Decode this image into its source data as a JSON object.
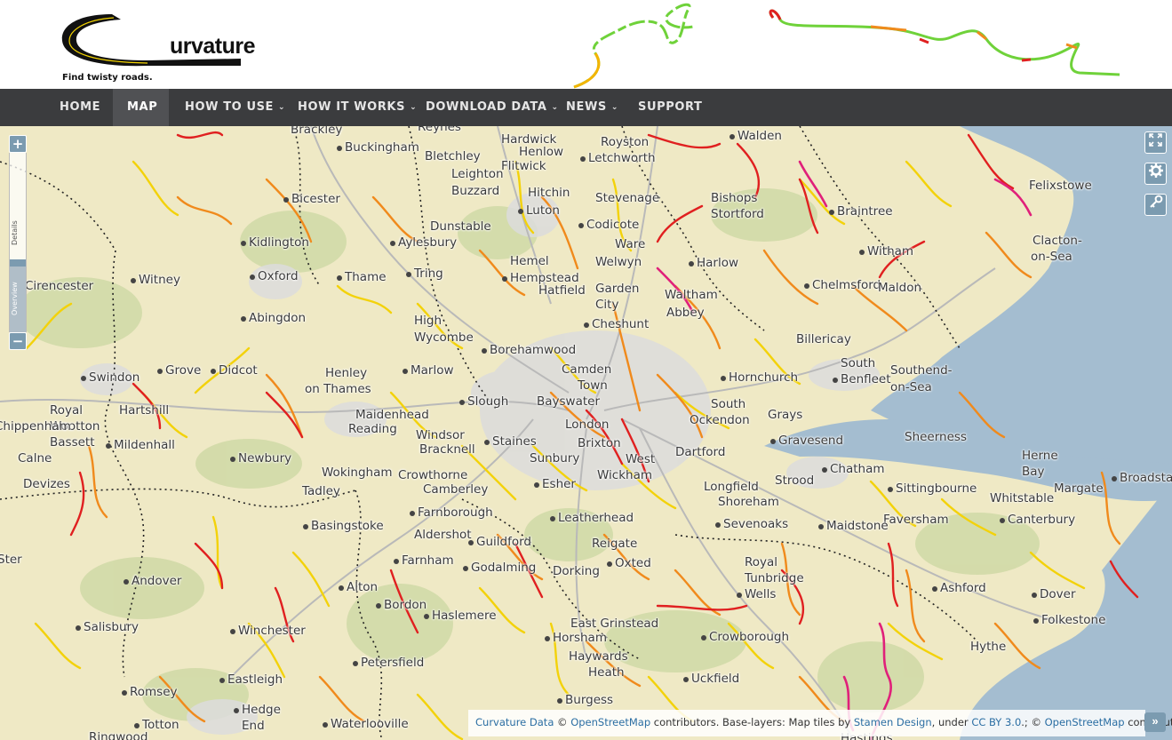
{
  "brand": {
    "logo_text": "urvature",
    "tagline": "Find twisty roads."
  },
  "nav": {
    "items": [
      {
        "label": "HOME",
        "dropdown": false,
        "active": false
      },
      {
        "label": "MAP",
        "dropdown": false,
        "active": true
      },
      {
        "label": "HOW TO USE",
        "dropdown": true,
        "active": false
      },
      {
        "label": "HOW IT WORKS",
        "dropdown": true,
        "active": false
      },
      {
        "label": "DOWNLOAD DATA",
        "dropdown": true,
        "active": false
      },
      {
        "label": "NEWS",
        "dropdown": true,
        "active": false
      },
      {
        "label": "SUPPORT",
        "dropdown": false,
        "active": false
      }
    ]
  },
  "map_controls": {
    "zoom_in": "+",
    "zoom_out": "−",
    "details_label": "Details",
    "overview_label": "Overview",
    "fullscreen_icon": "fullscreen-icon",
    "settings_icon": "gear-icon",
    "key_icon": "key-icon",
    "attribution_toggle": "»"
  },
  "attribution": {
    "curvature_link": "Curvature Data",
    "copyright": "©",
    "osm_link": "OpenStreetMap",
    "text1": "contributors. Base-layers: Map tiles by",
    "stamen_link": "Stamen Design",
    "text2": ", under",
    "cc_link": "CC BY 3.0",
    "text3": ".; ©",
    "osm_link2": "OpenStreetMap",
    "text4": "contributors."
  },
  "places": [
    {
      "name": "Brackley"
    },
    {
      "name": "Reynes"
    },
    {
      "name": "Hardwick"
    },
    {
      "name": "Royston"
    },
    {
      "name": "Walden"
    },
    {
      "name": "Buckingham"
    },
    {
      "name": "Henlow"
    },
    {
      "name": "Letchworth"
    },
    {
      "name": "Bletchley"
    },
    {
      "name": "Flitwick"
    },
    {
      "name": "Leighton"
    },
    {
      "name": "Buzzard"
    },
    {
      "name": "Hitchin"
    },
    {
      "name": "Stevenage"
    },
    {
      "name": "Bishops"
    },
    {
      "name": "Felixstowe"
    },
    {
      "name": "Bicester"
    },
    {
      "name": "Luton"
    },
    {
      "name": "Stortford"
    },
    {
      "name": "Braintree"
    },
    {
      "name": "Dunstable"
    },
    {
      "name": "Codicote"
    },
    {
      "name": "Ware"
    },
    {
      "name": "Kidlington"
    },
    {
      "name": "Aylesbury"
    },
    {
      "name": "Witham"
    },
    {
      "name": "Clacton-"
    },
    {
      "name": "on-Sea"
    },
    {
      "name": "Hemel"
    },
    {
      "name": "Harlow"
    },
    {
      "name": "Hempstead"
    },
    {
      "name": "Welwyn"
    },
    {
      "name": "Garden"
    },
    {
      "name": "City"
    },
    {
      "name": "Cirencester"
    },
    {
      "name": "Witney"
    },
    {
      "name": "Oxford"
    },
    {
      "name": "Thame"
    },
    {
      "name": "Tring"
    },
    {
      "name": "Hatfield"
    },
    {
      "name": "Waltham"
    },
    {
      "name": "Abbey"
    },
    {
      "name": "Chelmsford"
    },
    {
      "name": "Maldon"
    },
    {
      "name": "Abingdon"
    },
    {
      "name": "High"
    },
    {
      "name": "Wycombe"
    },
    {
      "name": "Cheshunt"
    },
    {
      "name": "Billericay"
    },
    {
      "name": "Swindon"
    },
    {
      "name": "Grove"
    },
    {
      "name": "Didcot"
    },
    {
      "name": "Henley"
    },
    {
      "name": "on Thames"
    },
    {
      "name": "Marlow"
    },
    {
      "name": "Borehamwood"
    },
    {
      "name": "Camden"
    },
    {
      "name": "Town"
    },
    {
      "name": "Hornchurch"
    },
    {
      "name": "South"
    },
    {
      "name": "Benfleet"
    },
    {
      "name": "Southend-"
    },
    {
      "name": "on-Sea"
    },
    {
      "name": "Royal"
    },
    {
      "name": "Wootton"
    },
    {
      "name": "Bassett"
    },
    {
      "name": "Hartshill"
    },
    {
      "name": "Slough"
    },
    {
      "name": "Bayswater"
    },
    {
      "name": "South"
    },
    {
      "name": "Ockendon"
    },
    {
      "name": "Grays"
    },
    {
      "name": "Chippenham"
    },
    {
      "name": "Maidenhead"
    },
    {
      "name": "Reading"
    },
    {
      "name": "Windsor"
    },
    {
      "name": "London"
    },
    {
      "name": "Gravesend"
    },
    {
      "name": "Sheerness"
    },
    {
      "name": "Mildenhall"
    },
    {
      "name": "Bracknell"
    },
    {
      "name": "Staines"
    },
    {
      "name": "Brixton"
    },
    {
      "name": "Dartford"
    },
    {
      "name": "Calne"
    },
    {
      "name": "Newbury"
    },
    {
      "name": "Wokingham"
    },
    {
      "name": "Sunbury"
    },
    {
      "name": "West"
    },
    {
      "name": "Wickham"
    },
    {
      "name": "Chatham"
    },
    {
      "name": "Herne"
    },
    {
      "name": "Bay"
    },
    {
      "name": "Devizes"
    },
    {
      "name": "Crowthorne"
    },
    {
      "name": "Camberley"
    },
    {
      "name": "Esher"
    },
    {
      "name": "Longfield"
    },
    {
      "name": "Strood"
    },
    {
      "name": "Sittingbourne"
    },
    {
      "name": "Margate"
    },
    {
      "name": "Broadstairs"
    },
    {
      "name": "Tadley"
    },
    {
      "name": "Shoreham"
    },
    {
      "name": "Whitstable"
    },
    {
      "name": "Farnborough"
    },
    {
      "name": "Leatherhead"
    },
    {
      "name": "Sevenoaks"
    },
    {
      "name": "Faversham"
    },
    {
      "name": "Canterbury"
    },
    {
      "name": "Basingstoke"
    },
    {
      "name": "Aldershot"
    },
    {
      "name": "Maidstone"
    },
    {
      "name": "Guildford"
    },
    {
      "name": "Reigate"
    },
    {
      "name": "Farnham"
    },
    {
      "name": "Godalming"
    },
    {
      "name": "Oxted"
    },
    {
      "name": "Dorking"
    },
    {
      "name": "Royal"
    },
    {
      "name": "Tunbridge"
    },
    {
      "name": "Wells"
    },
    {
      "name": "Andover"
    },
    {
      "name": "Alton"
    },
    {
      "name": "Ashford"
    },
    {
      "name": "Dover"
    },
    {
      "name": "Bordon"
    },
    {
      "name": "Haslemere"
    },
    {
      "name": "East Grinstead"
    },
    {
      "name": "Folkestone"
    },
    {
      "name": "Salisbury"
    },
    {
      "name": "Winchester"
    },
    {
      "name": "Horsham"
    },
    {
      "name": "Crowborough"
    },
    {
      "name": "Hythe"
    },
    {
      "name": "Petersfield"
    },
    {
      "name": "Haywards"
    },
    {
      "name": "Heath"
    },
    {
      "name": "Eastleigh"
    },
    {
      "name": "Uckfield"
    },
    {
      "name": "Romsey"
    },
    {
      "name": "Burgess"
    },
    {
      "name": "Hedge"
    },
    {
      "name": "End"
    },
    {
      "name": "Totton"
    },
    {
      "name": "Waterlooville"
    },
    {
      "name": "Ringwood"
    },
    {
      "name": "Hastings"
    },
    {
      "name": "Oxford"
    },
    {
      "name": "Ster"
    }
  ],
  "colors": {
    "navbar_bg": "#3b3c3e",
    "navbar_active": "#505154",
    "sea": "#a4bdd0",
    "land": "#efe9c5",
    "road_yellow": "#f3d20a",
    "road_orange": "#f08a1c",
    "road_red": "#e02020",
    "road_pink": "#e0207a",
    "control_blue": "#7b9bb0",
    "link_blue": "#2b6ea3"
  }
}
